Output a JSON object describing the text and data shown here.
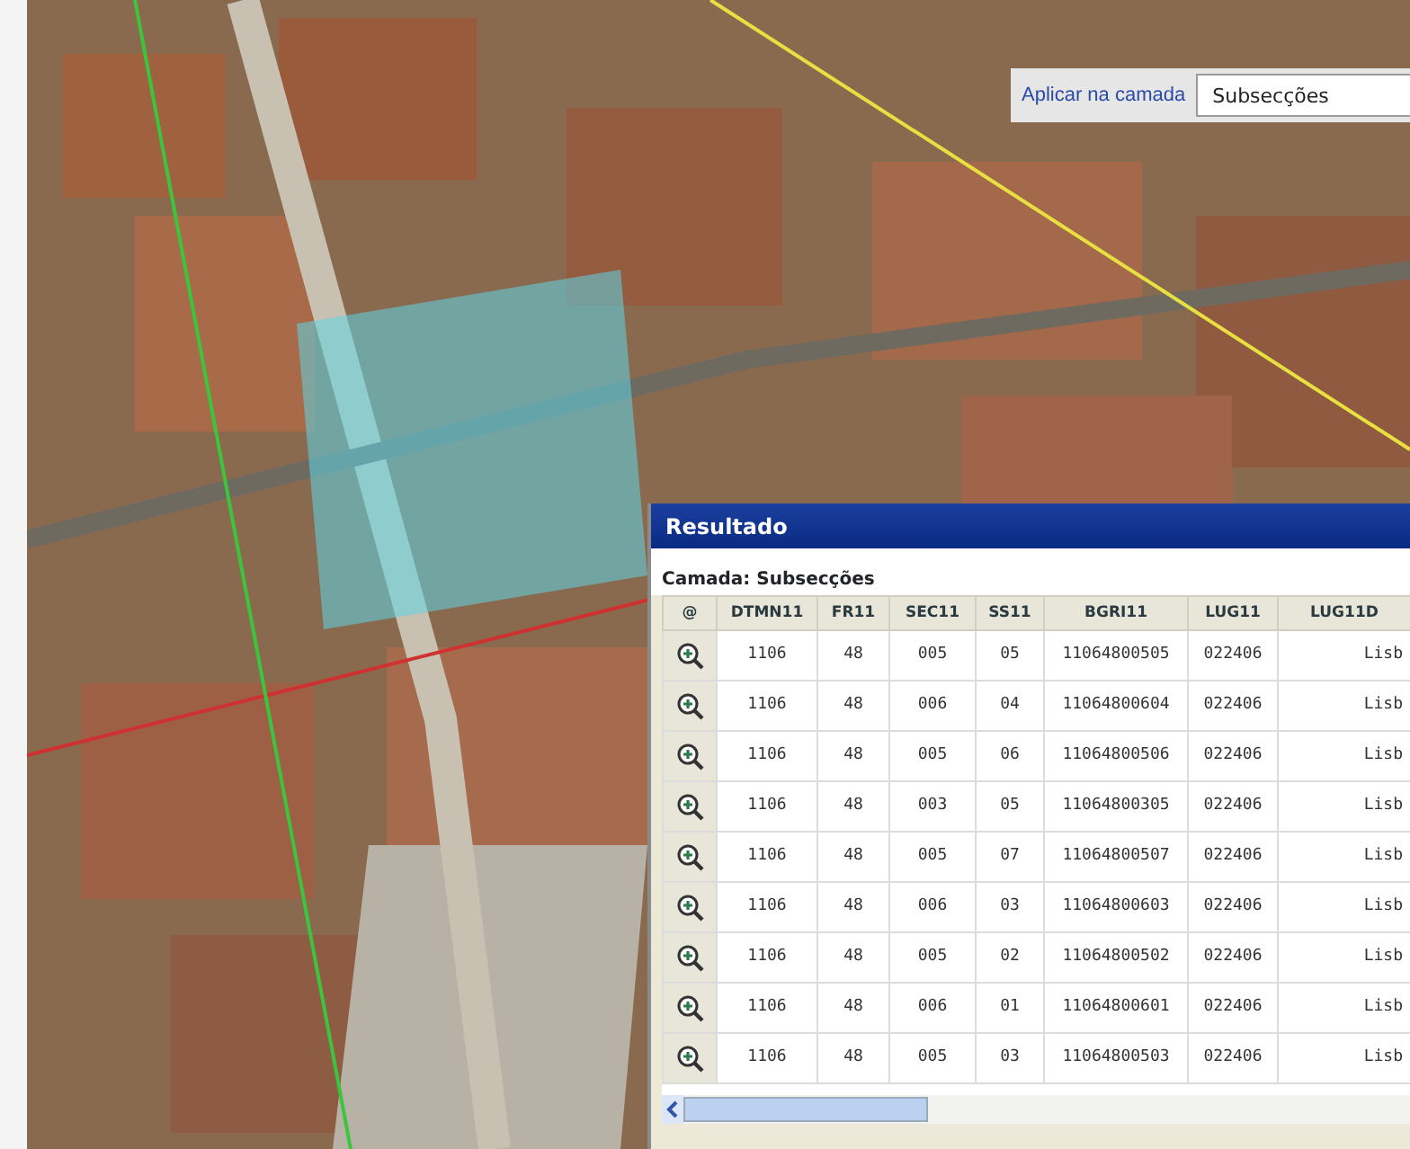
{
  "layer_selector": {
    "label": "Aplicar na camada",
    "value": "Subsecções"
  },
  "results_panel": {
    "title": "Resultado",
    "layer_caption": "Camada: Subsecções",
    "zoom_column_header": "@",
    "columns": [
      "DTMN11",
      "FR11",
      "SEC11",
      "SS11",
      "BGRI11",
      "LUG11",
      "LUG11D"
    ],
    "rows": [
      [
        "1106",
        "48",
        "005",
        "05",
        "11064800505",
        "022406",
        "Lisb"
      ],
      [
        "1106",
        "48",
        "006",
        "04",
        "11064800604",
        "022406",
        "Lisb"
      ],
      [
        "1106",
        "48",
        "005",
        "06",
        "11064800506",
        "022406",
        "Lisb"
      ],
      [
        "1106",
        "48",
        "003",
        "05",
        "11064800305",
        "022406",
        "Lisb"
      ],
      [
        "1106",
        "48",
        "005",
        "07",
        "11064800507",
        "022406",
        "Lisb"
      ],
      [
        "1106",
        "48",
        "006",
        "03",
        "11064800603",
        "022406",
        "Lisb"
      ],
      [
        "1106",
        "48",
        "005",
        "02",
        "11064800502",
        "022406",
        "Lisb"
      ],
      [
        "1106",
        "48",
        "006",
        "01",
        "11064800601",
        "022406",
        "Lisb"
      ],
      [
        "1106",
        "48",
        "005",
        "03",
        "11064800503",
        "022406",
        "Lisb"
      ]
    ]
  }
}
